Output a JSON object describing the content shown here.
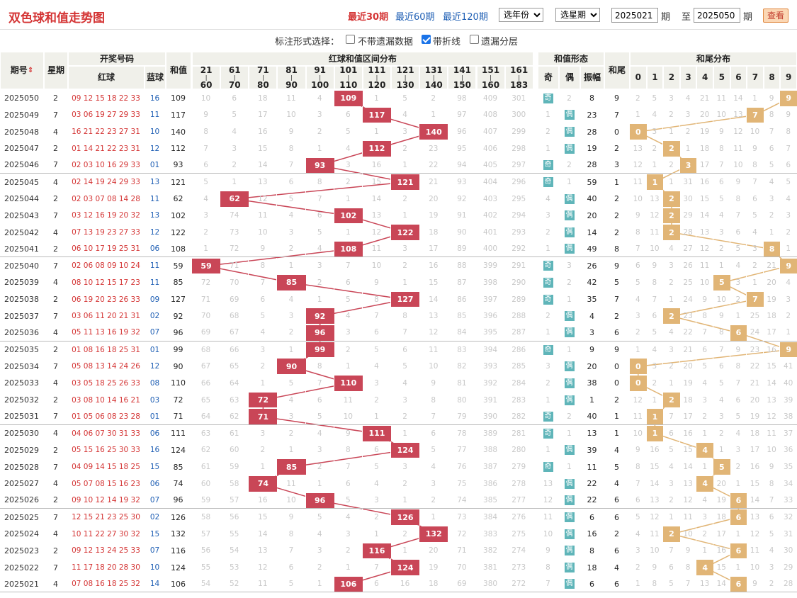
{
  "title": "双色球和值走势图",
  "periods_links": [
    {
      "label": "最近30期",
      "active": true
    },
    {
      "label": "最近60期",
      "active": false
    },
    {
      "label": "最近120期",
      "active": false
    }
  ],
  "year_select": "选年份",
  "period_select": "选星期",
  "from_value": "2025021",
  "from_suffix": "期",
  "to_label": "至",
  "to_value": "2025050",
  "to_suffix": "期",
  "query_button": "查看",
  "options": {
    "label": "标注形式选择：",
    "items": [
      {
        "label": "不带遗漏数据",
        "checked": false
      },
      {
        "label": "带折线",
        "checked": true
      },
      {
        "label": "遗漏分层",
        "checked": false
      }
    ]
  },
  "headers": {
    "period": "期号",
    "weekday": "星期",
    "draw": "开奖号码",
    "red": "红球",
    "blue": "蓝球",
    "sum": "和值",
    "dist": "红球和值区间分布",
    "ranges": [
      [
        "21",
        "60"
      ],
      [
        "61",
        "70"
      ],
      [
        "71",
        "80"
      ],
      [
        "81",
        "90"
      ],
      [
        "91",
        "100"
      ],
      [
        "101",
        "110"
      ],
      [
        "111",
        "120"
      ],
      [
        "121",
        "130"
      ],
      [
        "131",
        "140"
      ],
      [
        "141",
        "150"
      ],
      [
        "151",
        "160"
      ],
      [
        "161",
        "183"
      ]
    ],
    "form": "和值形态",
    "odd": "奇",
    "even": "偶",
    "amp": "振幅",
    "tail": "和尾",
    "tail_dist": "和尾分布",
    "digits": [
      "0",
      "1",
      "2",
      "3",
      "4",
      "5",
      "6",
      "7",
      "8",
      "9"
    ]
  },
  "rows": [
    {
      "p": "2025050",
      "w": "2",
      "red": "09 12 15 18 22 33",
      "blue": "16",
      "sum": "109",
      "r": [
        10,
        6,
        18,
        11,
        4,
        "*",
        1,
        5,
        2,
        98,
        409,
        301
      ],
      "odd": "奇",
      "even": "2",
      "amp": "8",
      "tail": "9",
      "t": [
        2,
        5,
        3,
        4,
        21,
        11,
        14,
        1,
        9,
        "*"
      ]
    },
    {
      "p": "2025049",
      "w": "7",
      "red": "03 06 19 27 29 33",
      "blue": "11",
      "sum": "117",
      "r": [
        9,
        5,
        17,
        10,
        3,
        6,
        "*",
        4,
        1,
        97,
        408,
        300
      ],
      "odd": "1",
      "even": "偶",
      "amp": "23",
      "tail": "7",
      "t": [
        1,
        4,
        2,
        3,
        20,
        10,
        13,
        "*",
        8,
        9
      ]
    },
    {
      "p": "2025048",
      "w": "4",
      "red": "16 21 22 23 27 31",
      "blue": "10",
      "sum": "140",
      "r": [
        8,
        4,
        16,
        9,
        2,
        5,
        1,
        3,
        "*",
        96,
        407,
        299
      ],
      "odd": "2",
      "even": "偶",
      "amp": "28",
      "tail": "0",
      "t": [
        "*",
        3,
        1,
        2,
        19,
        9,
        12,
        10,
        7,
        8
      ]
    },
    {
      "p": "2025047",
      "w": "2",
      "red": "01 14 21 22 23 31",
      "blue": "12",
      "sum": "112",
      "r": [
        7,
        3,
        15,
        8,
        1,
        4,
        "*",
        2,
        23,
        95,
        406,
        298
      ],
      "odd": "1",
      "even": "偶",
      "amp": "19",
      "tail": "2",
      "t": [
        13,
        2,
        "*",
        1,
        18,
        8,
        11,
        9,
        6,
        7
      ]
    },
    {
      "p": "2025046",
      "w": "7",
      "red": "02 03 10 16 29 33",
      "blue": "01",
      "sum": "93",
      "r": [
        6,
        2,
        14,
        7,
        "*",
        3,
        16,
        1,
        22,
        94,
        405,
        297
      ],
      "odd": "奇",
      "even": "2",
      "amp": "28",
      "tail": "3",
      "t": [
        12,
        1,
        2,
        "*",
        17,
        7,
        10,
        8,
        5,
        6
      ]
    },
    {
      "p": "2025045",
      "w": "4",
      "red": "02 14 19 24 29 33",
      "blue": "13",
      "sum": "121",
      "r": [
        5,
        1,
        13,
        6,
        8,
        2,
        15,
        "*",
        21,
        93,
        404,
        296
      ],
      "odd": "奇",
      "even": "1",
      "amp": "59",
      "tail": "1",
      "t": [
        11,
        "*",
        1,
        31,
        16,
        6,
        9,
        7,
        4,
        5
      ]
    },
    {
      "p": "2025044",
      "w": "2",
      "red": "02 03 07 08 14 28",
      "blue": "11",
      "sum": "62",
      "r": [
        4,
        "*",
        12,
        5,
        7,
        1,
        14,
        2,
        20,
        92,
        403,
        295
      ],
      "odd": "4",
      "even": "偶",
      "amp": "40",
      "tail": "2",
      "t": [
        10,
        13,
        "*",
        30,
        15,
        5,
        8,
        6,
        3,
        4
      ]
    },
    {
      "p": "2025043",
      "w": "7",
      "red": "03 12 16 19 20 32",
      "blue": "13",
      "sum": "102",
      "r": [
        3,
        74,
        11,
        4,
        6,
        "*",
        13,
        1,
        19,
        91,
        402,
        294
      ],
      "odd": "3",
      "even": "偶",
      "amp": "20",
      "tail": "2",
      "t": [
        9,
        12,
        "*",
        29,
        14,
        4,
        7,
        5,
        2,
        3
      ]
    },
    {
      "p": "2025042",
      "w": "4",
      "red": "07 13 19 23 27 33",
      "blue": "12",
      "sum": "122",
      "r": [
        2,
        73,
        10,
        3,
        5,
        1,
        12,
        "*",
        18,
        90,
        401,
        293
      ],
      "odd": "2",
      "even": "偶",
      "amp": "14",
      "tail": "2",
      "t": [
        8,
        11,
        "*",
        28,
        13,
        3,
        6,
        4,
        1,
        2
      ]
    },
    {
      "p": "2025041",
      "w": "2",
      "red": "06 10 17 19 25 31",
      "blue": "06",
      "sum": "108",
      "r": [
        1,
        72,
        9,
        2,
        4,
        "*",
        11,
        3,
        17,
        89,
        400,
        292
      ],
      "odd": "1",
      "even": "偶",
      "amp": "49",
      "tail": "8",
      "t": [
        7,
        10,
        4,
        27,
        12,
        2,
        5,
        3,
        "*",
        1
      ]
    },
    {
      "p": "2025040",
      "w": "7",
      "red": "02 06 08 09 10 24",
      "blue": "11",
      "sum": "59",
      "r": [
        "*",
        71,
        8,
        1,
        3,
        7,
        10,
        2,
        16,
        88,
        399,
        291
      ],
      "odd": "奇",
      "even": "3",
      "amp": "26",
      "tail": "9",
      "t": [
        6,
        9,
        3,
        26,
        11,
        1,
        4,
        2,
        21,
        "*"
      ]
    },
    {
      "p": "2025039",
      "w": "4",
      "red": "08 10 12 15 17 23",
      "blue": "11",
      "sum": "85",
      "r": [
        72,
        70,
        7,
        "*",
        2,
        6,
        9,
        1,
        15,
        87,
        398,
        290
      ],
      "odd": "奇",
      "even": "2",
      "amp": "42",
      "tail": "5",
      "t": [
        5,
        8,
        2,
        25,
        10,
        "*",
        3,
        1,
        20,
        4
      ]
    },
    {
      "p": "2025038",
      "w": "2",
      "red": "06 19 20 23 26 33",
      "blue": "09",
      "sum": "127",
      "r": [
        71,
        69,
        6,
        4,
        1,
        5,
        8,
        "*",
        14,
        86,
        397,
        289
      ],
      "odd": "奇",
      "even": "1",
      "amp": "35",
      "tail": "7",
      "t": [
        4,
        7,
        1,
        24,
        9,
        10,
        2,
        "*",
        19,
        3
      ]
    },
    {
      "p": "2025037",
      "w": "7",
      "red": "03 06 11 20 21 31",
      "blue": "02",
      "sum": "92",
      "r": [
        70,
        68,
        5,
        3,
        "*",
        4,
        7,
        8,
        13,
        85,
        396,
        288
      ],
      "odd": "2",
      "even": "偶",
      "amp": "4",
      "tail": "2",
      "t": [
        3,
        6,
        "*",
        23,
        8,
        9,
        1,
        25,
        18,
        2
      ]
    },
    {
      "p": "2025036",
      "w": "4",
      "red": "05 11 13 16 19 32",
      "blue": "07",
      "sum": "96",
      "r": [
        69,
        67,
        4,
        2,
        "*",
        3,
        6,
        7,
        12,
        84,
        395,
        287
      ],
      "odd": "1",
      "even": "偶",
      "amp": "3",
      "tail": "6",
      "t": [
        2,
        5,
        4,
        22,
        7,
        8,
        "*",
        24,
        17,
        1
      ]
    },
    {
      "p": "2025035",
      "w": "2",
      "red": "01 08 16 18 25 31",
      "blue": "01",
      "sum": "99",
      "r": [
        68,
        66,
        3,
        1,
        "*",
        2,
        5,
        6,
        11,
        83,
        394,
        286
      ],
      "odd": "奇",
      "even": "1",
      "amp": "9",
      "tail": "9",
      "t": [
        1,
        4,
        3,
        21,
        6,
        7,
        9,
        23,
        16,
        "*"
      ]
    },
    {
      "p": "2025034",
      "w": "7",
      "red": "05 08 13 14 24 26",
      "blue": "12",
      "sum": "90",
      "r": [
        67,
        65,
        2,
        "*",
        8,
        1,
        4,
        5,
        10,
        82,
        393,
        285
      ],
      "odd": "3",
      "even": "偶",
      "amp": "20",
      "tail": "0",
      "t": [
        "*",
        3,
        2,
        20,
        5,
        6,
        8,
        22,
        15,
        41
      ]
    },
    {
      "p": "2025033",
      "w": "4",
      "red": "03 05 18 25 26 33",
      "blue": "08",
      "sum": "110",
      "r": [
        66,
        64,
        1,
        5,
        7,
        "*",
        3,
        4,
        9,
        81,
        392,
        284
      ],
      "odd": "2",
      "even": "偶",
      "amp": "38",
      "tail": "0",
      "t": [
        "*",
        2,
        1,
        19,
        4,
        5,
        7,
        21,
        14,
        40
      ]
    },
    {
      "p": "2025032",
      "w": "2",
      "red": "03 08 10 14 16 21",
      "blue": "03",
      "sum": "72",
      "r": [
        65,
        63,
        "*",
        4,
        6,
        11,
        2,
        3,
        8,
        80,
        391,
        283
      ],
      "odd": "1",
      "even": "偶",
      "amp": "1",
      "tail": "2",
      "t": [
        12,
        1,
        "*",
        18,
        3,
        4,
        6,
        20,
        13,
        39
      ]
    },
    {
      "p": "2025031",
      "w": "7",
      "red": "01 05 06 08 23 28",
      "blue": "01",
      "sum": "71",
      "r": [
        64,
        62,
        "*",
        3,
        5,
        10,
        1,
        2,
        7,
        79,
        390,
        282
      ],
      "odd": "奇",
      "even": "2",
      "amp": "40",
      "tail": "1",
      "t": [
        11,
        "*",
        7,
        17,
        2,
        3,
        5,
        19,
        12,
        38
      ]
    },
    {
      "p": "2025030",
      "w": "4",
      "red": "04 06 07 30 31 33",
      "blue": "06",
      "sum": "111",
      "r": [
        63,
        61,
        3,
        2,
        4,
        9,
        "*",
        1,
        6,
        78,
        389,
        281
      ],
      "odd": "奇",
      "even": "1",
      "amp": "13",
      "tail": "1",
      "t": [
        10,
        "*",
        6,
        16,
        1,
        2,
        4,
        18,
        11,
        37
      ]
    },
    {
      "p": "2025029",
      "w": "2",
      "red": "05 15 16 25 30 33",
      "blue": "16",
      "sum": "124",
      "r": [
        62,
        60,
        2,
        1,
        3,
        8,
        6,
        "*",
        5,
        77,
        388,
        280
      ],
      "odd": "1",
      "even": "偶",
      "amp": "39",
      "tail": "4",
      "t": [
        9,
        16,
        5,
        15,
        "*",
        1,
        3,
        17,
        10,
        36
      ]
    },
    {
      "p": "2025028",
      "w": "7",
      "red": "04 09 14 15 18 25",
      "blue": "15",
      "sum": "85",
      "r": [
        61,
        59,
        1,
        "*",
        2,
        7,
        5,
        3,
        4,
        76,
        387,
        279
      ],
      "odd": "奇",
      "even": "1",
      "amp": "11",
      "tail": "5",
      "t": [
        8,
        15,
        4,
        14,
        1,
        "*",
        2,
        16,
        9,
        35
      ]
    },
    {
      "p": "2025027",
      "w": "4",
      "red": "05 07 08 15 16 23",
      "blue": "06",
      "sum": "74",
      "r": [
        60,
        58,
        "*",
        11,
        1,
        6,
        4,
        2,
        3,
        75,
        386,
        278
      ],
      "odd": "13",
      "even": "偶",
      "amp": "22",
      "tail": "4",
      "t": [
        7,
        14,
        3,
        13,
        "*",
        20,
        1,
        15,
        8,
        34
      ]
    },
    {
      "p": "2025026",
      "w": "2",
      "red": "09 10 12 14 19 32",
      "blue": "07",
      "sum": "96",
      "r": [
        59,
        57,
        16,
        10,
        "*",
        5,
        3,
        1,
        2,
        74,
        385,
        277
      ],
      "odd": "12",
      "even": "偶",
      "amp": "22",
      "tail": "6",
      "t": [
        6,
        13,
        2,
        12,
        4,
        19,
        "*",
        14,
        7,
        33
      ]
    },
    {
      "p": "2025025",
      "w": "7",
      "red": "12 15 21 23 25 30",
      "blue": "02",
      "sum": "126",
      "r": [
        58,
        56,
        15,
        9,
        5,
        4,
        2,
        "*",
        1,
        73,
        384,
        276
      ],
      "odd": "11",
      "even": "偶",
      "amp": "6",
      "tail": "6",
      "t": [
        5,
        12,
        1,
        11,
        3,
        18,
        "*",
        13,
        6,
        32
      ]
    },
    {
      "p": "2025024",
      "w": "4",
      "red": "10 11 22 27 30 32",
      "blue": "15",
      "sum": "132",
      "r": [
        57,
        55,
        14,
        8,
        4,
        3,
        1,
        2,
        "*",
        72,
        383,
        275
      ],
      "odd": "10",
      "even": "偶",
      "amp": "16",
      "tail": "2",
      "t": [
        4,
        11,
        "*",
        10,
        2,
        17,
        1,
        12,
        5,
        31
      ]
    },
    {
      "p": "2025023",
      "w": "2",
      "red": "09 12 13 24 25 33",
      "blue": "07",
      "sum": "116",
      "r": [
        56,
        54,
        13,
        7,
        3,
        2,
        "*",
        1,
        20,
        71,
        382,
        274
      ],
      "odd": "9",
      "even": "偶",
      "amp": "8",
      "tail": "6",
      "t": [
        3,
        10,
        7,
        9,
        1,
        16,
        "*",
        11,
        4,
        30
      ]
    },
    {
      "p": "2025022",
      "w": "7",
      "red": "11 17 18 20 28 30",
      "blue": "10",
      "sum": "124",
      "r": [
        55,
        53,
        12,
        6,
        2,
        1,
        7,
        "*",
        19,
        70,
        381,
        273
      ],
      "odd": "8",
      "even": "偶",
      "amp": "18",
      "tail": "4",
      "t": [
        2,
        9,
        6,
        8,
        "*",
        15,
        1,
        10,
        3,
        29
      ]
    },
    {
      "p": "2025021",
      "w": "4",
      "red": "07 08 16 18 25 32",
      "blue": "14",
      "sum": "106",
      "r": [
        54,
        52,
        11,
        5,
        1,
        "*",
        6,
        16,
        18,
        69,
        380,
        272
      ],
      "odd": "7",
      "even": "偶",
      "amp": "6",
      "tail": "6",
      "t": [
        1,
        8,
        5,
        7,
        13,
        14,
        "*",
        9,
        2,
        28
      ]
    }
  ]
}
